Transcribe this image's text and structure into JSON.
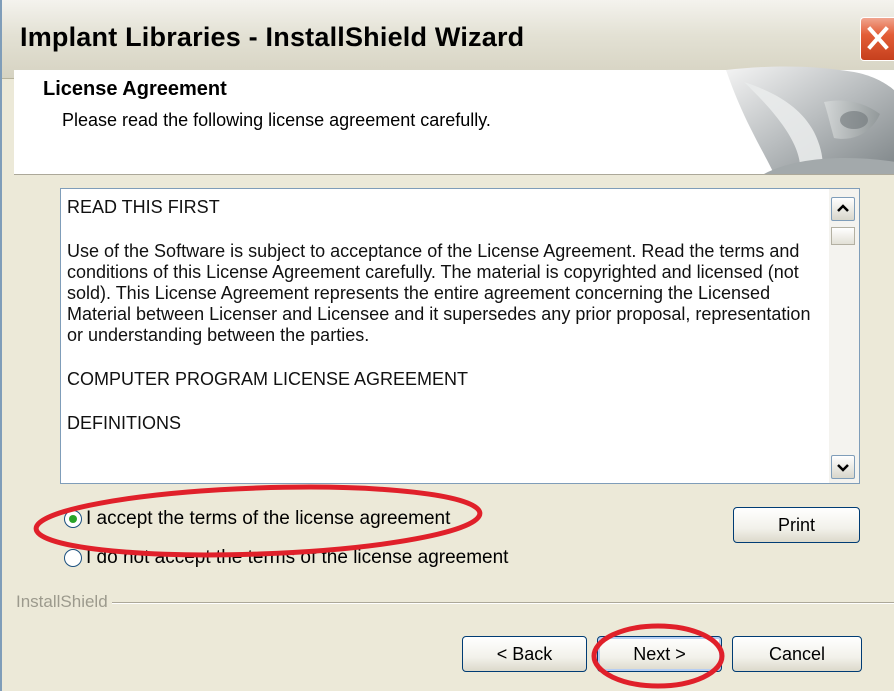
{
  "window": {
    "title": "Implant Libraries - InstallShield Wizard"
  },
  "header": {
    "title": "License Agreement",
    "subtitle": "Please read the following license agreement carefully."
  },
  "license": {
    "paragraphs": [
      "READ THIS FIRST",
      "Use of the Software is subject to acceptance of the License Agreement. Read the terms and conditions of this License Agreement carefully. The material is copyrighted and licensed (not sold). This License Agreement represents the entire agreement concerning the Licensed Material between Licenser and Licensee and it supersedes any prior proposal, representation or understanding between the parties.",
      "COMPUTER PROGRAM LICENSE AGREEMENT",
      "DEFINITIONS"
    ]
  },
  "options": {
    "accept": "I accept the terms of the license agreement",
    "decline": "I do not accept the terms of the license agreement",
    "selected": "accept"
  },
  "buttons": {
    "print": "Print",
    "back": "< Back",
    "next": "Next >",
    "cancel": "Cancel"
  },
  "branding": "InstallShield",
  "colors": {
    "annotation": "#e0202a",
    "radio_selected": "#29a329",
    "close_button": "#e35d37"
  }
}
